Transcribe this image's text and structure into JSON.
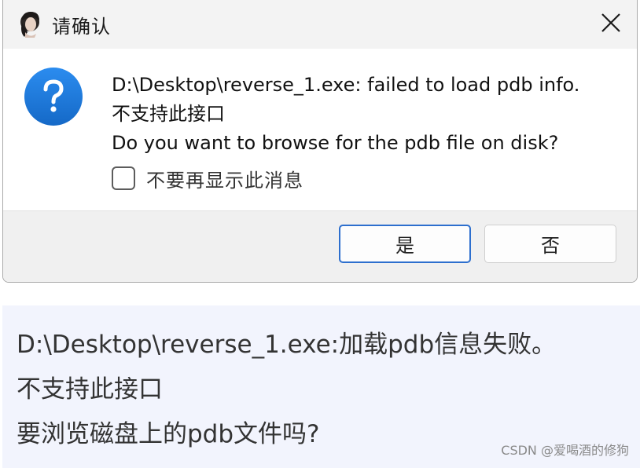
{
  "dialog": {
    "title": "请确认",
    "icon_name": "help-question-icon",
    "message_lines": [
      "D:\\Desktop\\reverse_1.exe: failed to load pdb info.",
      "不支持此接口",
      "Do you want to browse for the pdb file on disk?"
    ],
    "checkbox": {
      "label": "不要再显示此消息",
      "checked": false
    },
    "buttons": {
      "yes_label": "是",
      "no_label": "否"
    }
  },
  "translation": {
    "lines": [
      "D:\\Desktop\\reverse_1.exe:加载pdb信息失败。",
      "不支持此接口",
      "要浏览磁盘上的pdb文件吗?"
    ]
  },
  "watermark": "CSDN @爱喝酒的修狗",
  "colors": {
    "accent": "#2d6fce",
    "help_icon": "#1f7fe0",
    "translation_bg": "#f2f4fd",
    "dialog_bg": "#f0f0f0"
  }
}
